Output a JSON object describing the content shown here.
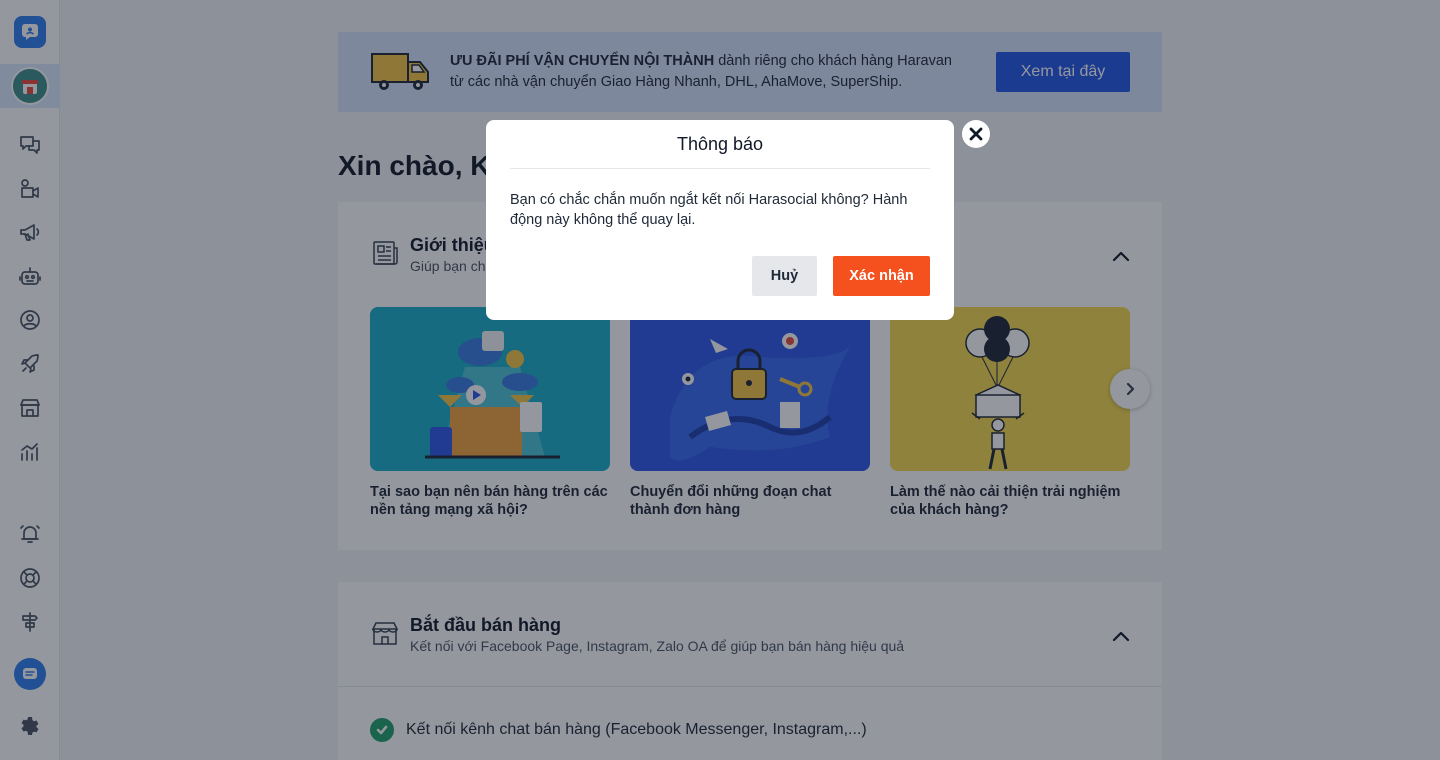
{
  "sidebar": {
    "items": [
      {
        "icon": "chat-bubbles-icon"
      },
      {
        "icon": "live-video-icon"
      },
      {
        "icon": "megaphone-icon"
      },
      {
        "icon": "robot-icon"
      },
      {
        "icon": "user-circle-icon"
      },
      {
        "icon": "rocket-icon"
      },
      {
        "icon": "store-icon"
      },
      {
        "icon": "analytics-chart-icon"
      },
      {
        "icon": "alarm-bell-icon"
      },
      {
        "icon": "help-lifebuoy-icon"
      },
      {
        "icon": "signpost-icon"
      },
      {
        "icon": "messenger-icon"
      },
      {
        "icon": "settings-gear-icon"
      }
    ]
  },
  "banner": {
    "bold": "ƯU ĐÃI PHÍ VẬN CHUYỂN NỘI THÀNH",
    "text1": " dành riêng cho khách hàng Haravan",
    "text2": "từ các nhà vận chuyển Giao Hàng Nhanh, DHL, AhaMove, SuperShip.",
    "button": "Xem tại đây"
  },
  "greeting": "Xin chào, Kh",
  "intro": {
    "title": "Giới thiệu",
    "subtitle": "Giúp bạn chu",
    "articles": [
      {
        "caption": "Tại sao bạn nên bán hàng trên các nền tảng mạng xã hội?",
        "color": "#1ab0c8"
      },
      {
        "caption": "Chuyển đổi những đoạn chat thành đơn hàng",
        "color": "#2c58e8"
      },
      {
        "caption": "Làm thế nào cải thiện trải nghiệm của khách hàng?",
        "color": "#f6d94e"
      }
    ]
  },
  "start": {
    "title": "Bắt đầu bán hàng",
    "subtitle": "Kết nối với Facebook Page, Instagram, Zalo OA để giúp bạn bán hàng hiệu quả",
    "step1": "Kết nối kênh chat bán hàng (Facebook Messenger, Instagram,...)"
  },
  "modal": {
    "title": "Thông báo",
    "body": "Bạn có chắc chắn muốn ngắt kết nối Harasocial không? Hành động này không thể quay lại.",
    "cancel": "Huỷ",
    "confirm": "Xác nhận"
  }
}
